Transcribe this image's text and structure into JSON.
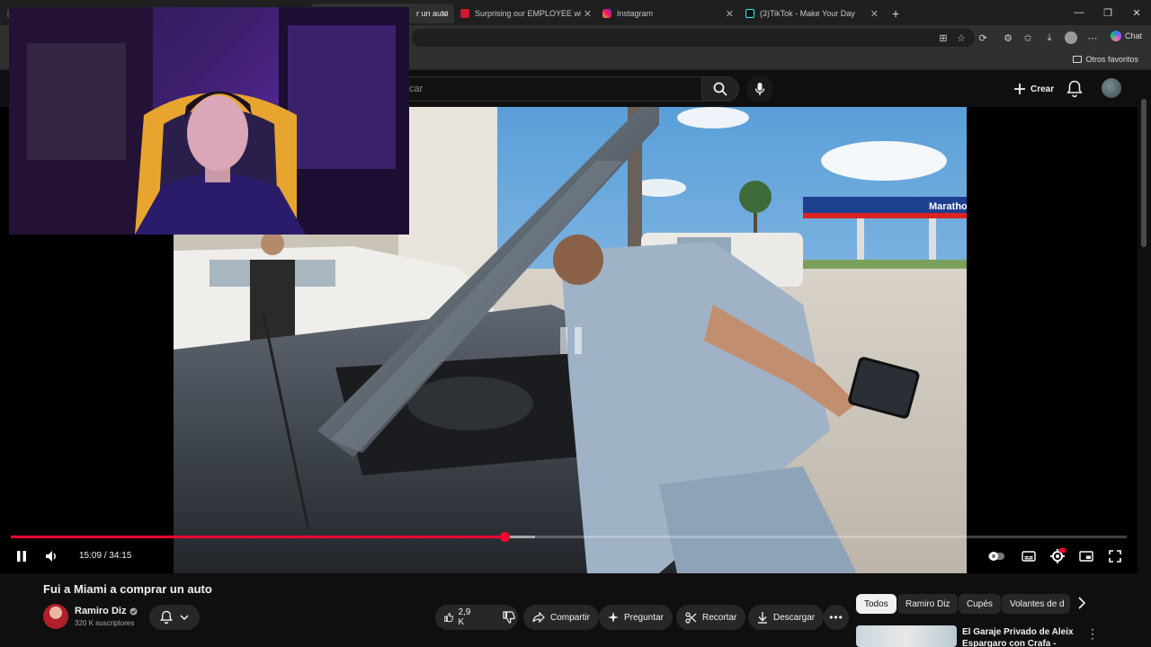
{
  "browser": {
    "tabs": [
      {
        "label": "r un auto",
        "active": true
      },
      {
        "label": "Surprising our EMPLOYEE with his",
        "active": false
      },
      {
        "label": "Instagram",
        "active": false
      },
      {
        "label": "(3)TikTok - Make Your Day",
        "active": false
      }
    ],
    "chat_label": "Chat",
    "bookmarks_folder": "Otros favoritos"
  },
  "header": {
    "search_placeholder": "car",
    "create_label": "Crear"
  },
  "player": {
    "current_time": "15:09",
    "duration": "34:15",
    "time_text": "15:09 / 34:15",
    "progress_fraction": 0.442,
    "buffered_fraction": 0.47,
    "state": "playing"
  },
  "video": {
    "title": "Fui a Miami a comprar un auto",
    "station_sign": "Marathon"
  },
  "channel": {
    "name": "Ramiro Diz",
    "subscribers": "320 K suscriptores"
  },
  "actions": {
    "likes": "2,9 K",
    "share": "Compartir",
    "ask": "Preguntar",
    "clip": "Recortar",
    "download": "Descargar"
  },
  "chips": [
    "Todos",
    "Ramiro Diz",
    "Cupés",
    "Volantes de d"
  ],
  "recommendation": {
    "title": "El Garaje Privado de Aleix Espargaro con Crafa - Episodi"
  },
  "colors": {
    "accent": "#ff0033",
    "background": "#0f0f0f",
    "chip_bg": "#272727"
  }
}
